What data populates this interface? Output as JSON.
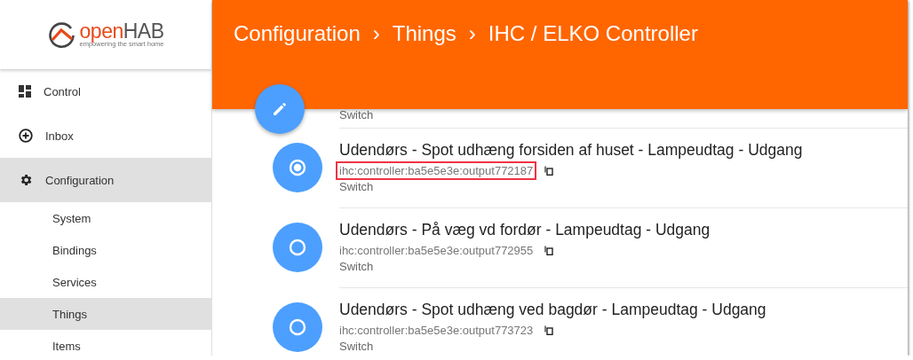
{
  "logo": {
    "word_start": "open",
    "word_end": "HAB",
    "tagline": "empowering the smart home"
  },
  "sidebar": {
    "items": [
      {
        "label": "Control",
        "selected": false
      },
      {
        "label": "Inbox",
        "selected": false
      },
      {
        "label": "Configuration",
        "selected": true,
        "children": [
          {
            "label": "System",
            "selected": false
          },
          {
            "label": "Bindings",
            "selected": false
          },
          {
            "label": "Services",
            "selected": false
          },
          {
            "label": "Things",
            "selected": true
          },
          {
            "label": "Items",
            "selected": false
          }
        ]
      }
    ]
  },
  "header": {
    "breadcrumb": [
      "Configuration",
      "Things",
      "IHC / ELKO Controller"
    ],
    "separator": "›"
  },
  "partial_row": {
    "type": "Switch"
  },
  "things": [
    {
      "title": "Udendørs - Spot udhæng forsiden af huset - Lampeudtag - Udgang",
      "uid": "ihc:controller:ba5e5e3e:output772187",
      "type": "Switch",
      "checked": true,
      "highlighted": true
    },
    {
      "title": "Udendørs - På væg vd fordør - Lampeudtag - Udgang",
      "uid": "ihc:controller:ba5e5e3e:output772955",
      "type": "Switch",
      "checked": false,
      "highlighted": false
    },
    {
      "title": "Udendørs - Spot udhæng ved bagdør - Lampeudtag - Udgang",
      "uid": "ihc:controller:ba5e5e3e:output773723",
      "type": "Switch",
      "checked": false,
      "highlighted": false
    }
  ]
}
